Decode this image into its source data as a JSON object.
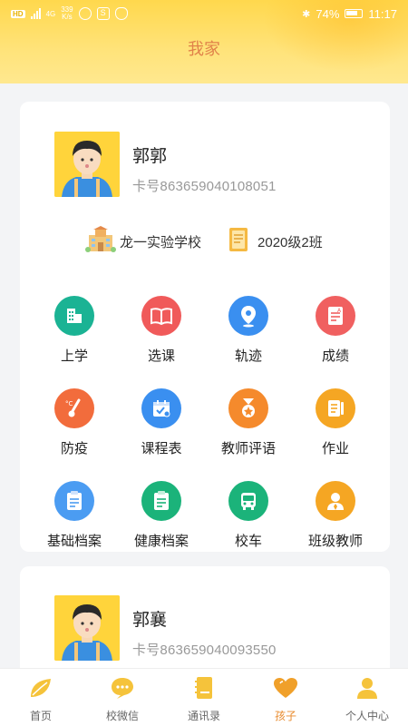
{
  "status_bar": {
    "network_tag": "HD",
    "net_type": "4G",
    "speed_value": "339",
    "speed_unit": "K/s",
    "battery": "74%",
    "time": "11:17"
  },
  "header": {
    "title": "我家"
  },
  "students": [
    {
      "name": "郭郭",
      "card_label": "卡号",
      "card_number": "863659040108051",
      "school": "龙一实验学校",
      "class": "2020级2班"
    },
    {
      "name": "郭襄",
      "card_label": "卡号",
      "card_number": "863659040093550"
    }
  ],
  "features": [
    {
      "label": "上学",
      "icon": "school-building-icon",
      "color": "#1bb394"
    },
    {
      "label": "选课",
      "icon": "open-book-icon",
      "color": "#f05a5a"
    },
    {
      "label": "轨迹",
      "icon": "location-pin-icon",
      "color": "#3a8ff0"
    },
    {
      "label": "成绩",
      "icon": "report-card-icon",
      "color": "#f06060"
    },
    {
      "label": "防疫",
      "icon": "thermometer-icon",
      "color": "#f26c3c"
    },
    {
      "label": "课程表",
      "icon": "calendar-icon",
      "color": "#3a8ff0"
    },
    {
      "label": "教师评语",
      "icon": "medal-icon",
      "color": "#f58a2c"
    },
    {
      "label": "作业",
      "icon": "homework-icon",
      "color": "#f5a623"
    },
    {
      "label": "基础档案",
      "icon": "folder-doc-icon",
      "color": "#4b9cf2"
    },
    {
      "label": "健康档案",
      "icon": "health-doc-icon",
      "color": "#1bb37a"
    },
    {
      "label": "校车",
      "icon": "bus-icon",
      "color": "#1bb37a"
    },
    {
      "label": "班级教师",
      "icon": "teacher-icon",
      "color": "#f5a623"
    }
  ],
  "bottom_nav": [
    {
      "label": "首页",
      "icon": "leaf-icon"
    },
    {
      "label": "校微信",
      "icon": "chat-bubble-icon"
    },
    {
      "label": "通讯录",
      "icon": "contacts-book-icon"
    },
    {
      "label": "孩子",
      "icon": "heart-icon",
      "active": true
    },
    {
      "label": "个人中心",
      "icon": "person-icon"
    }
  ],
  "colors": {
    "header_yellow": "#ffd84d",
    "title_orange": "#e0824a",
    "active_nav": "#e88a2c",
    "nav_icon": "#f5c33b"
  }
}
